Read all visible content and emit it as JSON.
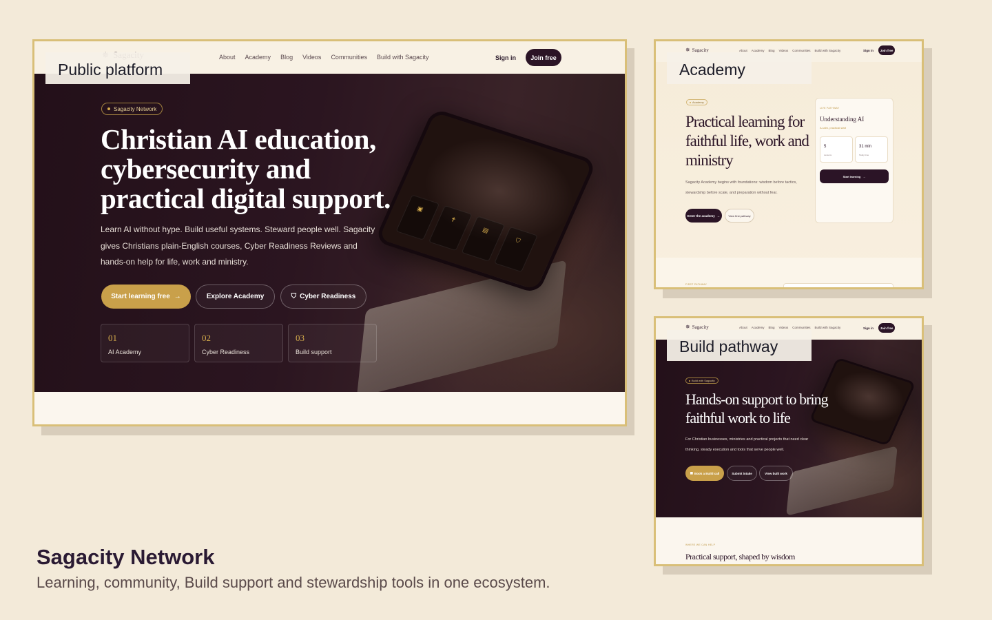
{
  "caption": {
    "title": "Sagacity Network",
    "subtitle": "Learning, community, Build support and stewardship tools in one ecosystem."
  },
  "colors": {
    "background": "#f3ead9",
    "frame_border": "#d9bf78",
    "accent": "#c9a04a",
    "dark": "#2b1426"
  },
  "public_platform": {
    "label": "Public platform",
    "nav": {
      "logo": "Sagacity",
      "links": [
        "About",
        "Academy",
        "Blog",
        "Videos",
        "Communities",
        "Build with Sagacity"
      ],
      "sign_in": "Sign in",
      "join": "Join free"
    },
    "hero": {
      "badge": "Sagacity Network",
      "headline_1": "Christian AI education,",
      "headline_2": "cybersecurity and",
      "headline_3": "practical digital support.",
      "body_1": "Learn AI without hype. Build useful systems. Steward people well. Sagacity",
      "body_2": "gives Christians plain-English courses, Cyber Readiness Reviews and",
      "body_3": "hands-on help for life, work and ministry.",
      "cta_primary": "Start learning free",
      "cta_secondary": "Explore Academy",
      "cta_tertiary": "Cyber Readiness",
      "stats": [
        {
          "num": "01",
          "label": "AI Academy"
        },
        {
          "num": "02",
          "label": "Cyber Readiness"
        },
        {
          "num": "03",
          "label": "Build support"
        }
      ]
    }
  },
  "academy": {
    "label": "Academy",
    "nav": {
      "logo": "Sagacity",
      "links": [
        "About",
        "Academy",
        "Blog",
        "Videos",
        "Communities",
        "Build with Sagacity"
      ],
      "sign_in": "Sign in",
      "join": "Join free"
    },
    "badge": "Academy",
    "headline_1": "Practical learning for",
    "headline_2": "faithful life, work and",
    "headline_3": "ministry",
    "body_1": "Sagacity Academy begins with foundations: wisdom before tactics,",
    "body_2": "stewardship before scale, and preparation without fear.",
    "cta_primary": "Enter the academy",
    "cta_secondary": "View first pathway",
    "card": {
      "eyebrow": "LIVE PATHWAY",
      "title": "Understanding AI",
      "subtitle": "A calm, practical start",
      "stat1_value": "5",
      "stat1_label": "Lessons",
      "stat2_value": "31 min",
      "stat2_label": "Study time",
      "button": "Start learning"
    },
    "footer_eyebrow": "FIRST PATHWAY"
  },
  "build": {
    "label": "Build pathway",
    "nav": {
      "logo": "Sagacity",
      "links": [
        "About",
        "Academy",
        "Blog",
        "Videos",
        "Communities",
        "Build with Sagacity"
      ],
      "sign_in": "Sign in",
      "join": "Join free"
    },
    "badge": "Build with Sagacity",
    "headline_1": "Hands-on support to bring",
    "headline_2": "faithful work to life",
    "body_1": "For Christian businesses, ministries and practical projects that need clear",
    "body_2": "thinking, steady execution and tools that serve people well.",
    "cta_primary": "Book a Build call",
    "cta_secondary": "Submit intake",
    "cta_tertiary": "View built work",
    "section_eyebrow": "WHERE WE CAN HELP",
    "section_title": "Practical support, shaped by wisdom"
  }
}
